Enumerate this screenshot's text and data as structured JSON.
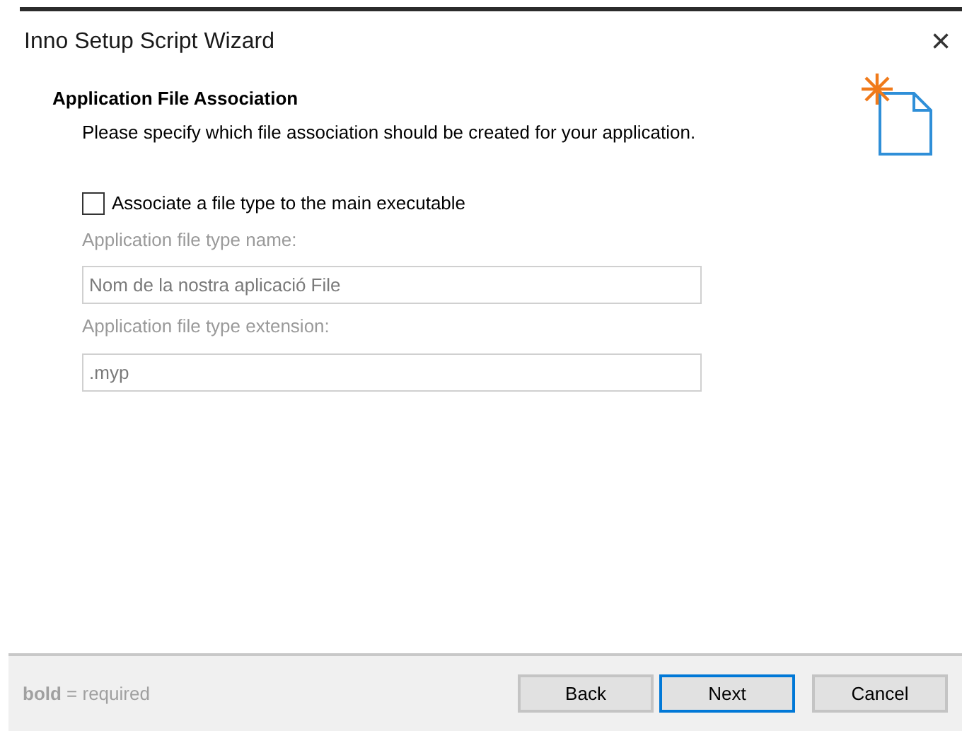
{
  "window": {
    "title": "Inno Setup Script Wizard",
    "close": "×"
  },
  "header": {
    "title": "Application File Association",
    "subtitle": "Please specify which file association should be created for your application."
  },
  "checkbox": {
    "label": "Associate a file type to the main executable",
    "checked": false
  },
  "fields": [
    {
      "label": "Application file type name:",
      "value": "Nom de la nostra aplicació File",
      "disabled": true
    },
    {
      "label": "Application file type extension:",
      "value": ".myp",
      "disabled": true
    }
  ],
  "footer": {
    "note": "**bold** = required"
  },
  "buttons": [
    {
      "label": "Back",
      "default": false
    },
    {
      "label": "Next",
      "default": true
    },
    {
      "label": "Cancel",
      "default": false
    }
  ]
}
